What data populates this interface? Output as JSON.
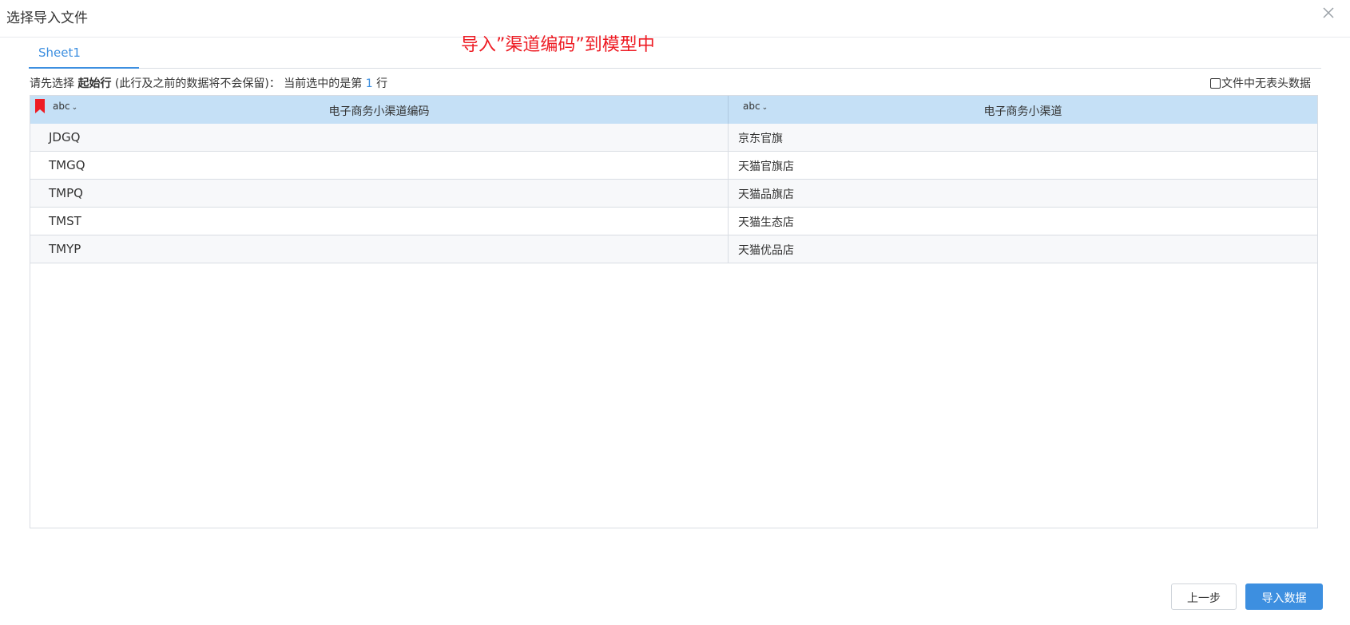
{
  "dialog": {
    "title": "选择导入文件",
    "close_icon": "close-icon"
  },
  "tabs": [
    {
      "label": "Sheet1",
      "active": true
    }
  ],
  "annotation": {
    "text": "导入”渠道编码”到模型中",
    "color": "#ee1c24"
  },
  "hint": {
    "prefix": "请先选择",
    "start_row": "起始行",
    "note": "(此行及之前的数据将不会保留)：",
    "current_prefix": "当前选中的是第",
    "current_row": "1",
    "suffix": "行"
  },
  "options": {
    "no_header_label": "文件中无表头数据",
    "no_header_checked": false
  },
  "table": {
    "columns": [
      {
        "type": "abc",
        "title": "电子商务小渠道编码"
      },
      {
        "type": "abc",
        "title": "电子商务小渠道"
      }
    ],
    "rows": [
      [
        "JDGQ",
        "京东官旗"
      ],
      [
        "TMGQ",
        "天猫官旗店"
      ],
      [
        "TMPQ",
        "天猫品旗店"
      ],
      [
        "TMST",
        "天猫生态店"
      ],
      [
        "TMYP",
        "天猫优品店"
      ]
    ]
  },
  "footer": {
    "prev_label": "上一步",
    "import_label": "导入数据"
  },
  "colors": {
    "accent": "#3d8fe0",
    "header_bg": "#c5e0f6",
    "bookmark": "#ee1c24"
  }
}
